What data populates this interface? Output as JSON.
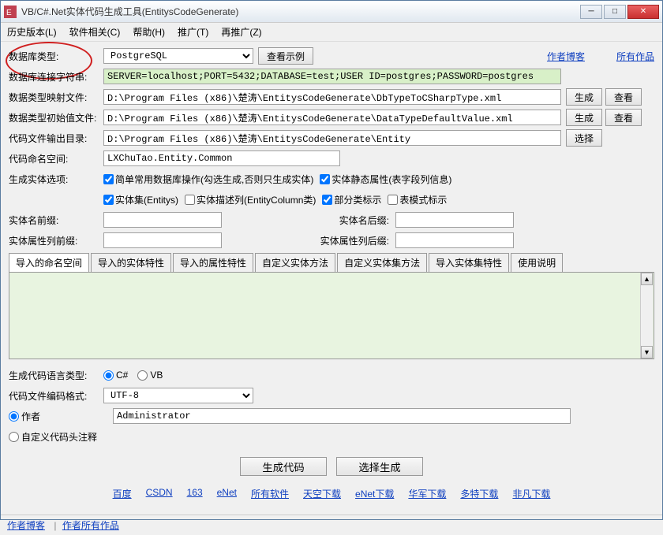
{
  "window": {
    "title": "VB/C#.Net实体代码生成工具(EntitysCodeGenerate)"
  },
  "menu": {
    "history": "历史版本(L)",
    "software": "软件相关(C)",
    "help": "帮助(H)",
    "promo": "推广(T)",
    "repromo": "再推广(Z)"
  },
  "labels": {
    "dbtype": "数据库类型:",
    "connstr": "数据库连接字符串:",
    "maptype": "数据类型映射文件:",
    "defval": "数据类型初始值文件:",
    "outdir": "代码文件输出目录:",
    "namespace": "代码命名空间:",
    "genopts": "生成实体选项:",
    "entprefix": "实体名前缀:",
    "entsuffix": "实体名后缀:",
    "propprefix": "实体属性列前缀:",
    "propsuffix": "实体属性列后缀:",
    "langtype": "生成代码语言类型:",
    "encoding": "代码文件编码格式:",
    "author": "作者",
    "customhead": "自定义代码头注释"
  },
  "fields": {
    "dbtype": "PostgreSQL",
    "connstr": "SERVER=localhost;PORT=5432;DATABASE=test;USER ID=postgres;PASSWORD=postgres",
    "maptype": "D:\\Program Files (x86)\\楚涛\\EntitysCodeGenerate\\DbTypeToCSharpType.xml",
    "defval": "D:\\Program Files (x86)\\楚涛\\EntitysCodeGenerate\\DataTypeDefaultValue.xml",
    "outdir": "D:\\Program Files (x86)\\楚涛\\EntitysCodeGenerate\\Entity",
    "namespace": "LXChuTao.Entity.Common",
    "encoding": "UTF-8",
    "author": "Administrator",
    "entprefix": "",
    "entsuffix": "",
    "propprefix": "",
    "propsuffix": ""
  },
  "buttons": {
    "viewsample": "查看示例",
    "gen": "生成",
    "view": "查看",
    "select": "选择",
    "gencode": "生成代码",
    "selectgen": "选择生成"
  },
  "checks": {
    "simpleop": "简单常用数据库操作(勾选生成,否则只生成实体)",
    "staticprop": "实体静态属性(表字段列信息)",
    "entityset": "实体集(Entitys)",
    "entitycol": "实体描述列(EntityColumn类)",
    "partial": "部分类标示",
    "tablemode": "表模式标示"
  },
  "radios": {
    "csharp": "C#",
    "vb": "VB"
  },
  "tabs": {
    "t0": "导入的命名空间",
    "t1": "导入的实体特性",
    "t2": "导入的属性特性",
    "t3": "自定义实体方法",
    "t4": "自定义实体集方法",
    "t5": "导入实体集特性",
    "t6": "使用说明"
  },
  "links": {
    "authorblog": "作者博客",
    "allworks": "所有作品",
    "baidu": "百度",
    "csdn": "CSDN",
    "163": "163",
    "enet": "eNet",
    "allsoft": "所有软件",
    "tiankong": "天空下载",
    "enetdl": "eNet下载",
    "huajun": "华军下载",
    "duote": "多特下载",
    "feifan": "非凡下载",
    "footerblog": "作者博客",
    "footerworks": "作者所有作品"
  }
}
